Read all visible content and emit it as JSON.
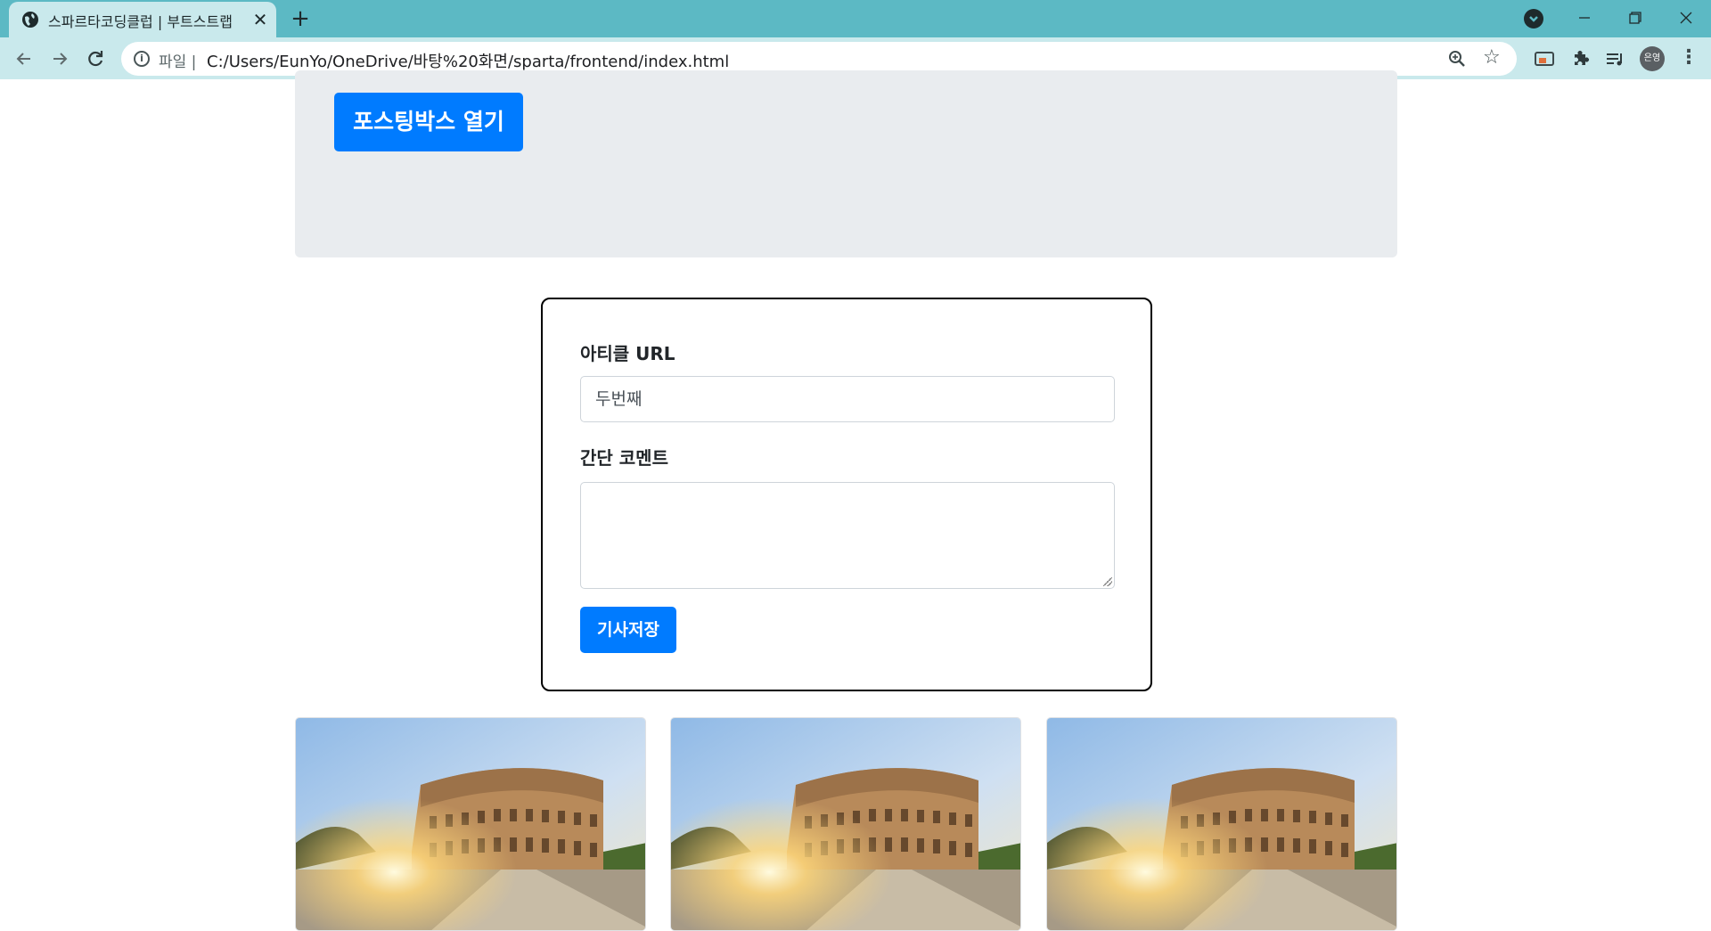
{
  "browser": {
    "tab_title": "스파르타코딩클럽 | 부트스트랩",
    "tab_close_glyph": "✕",
    "new_tab_glyph": "+",
    "address_chip": "파일 |",
    "url": "C:/Users/EunYo/OneDrive/바탕%20화면/sparta/frontend/index.html",
    "avatar_label": "은영",
    "icons": {
      "back": "arrow-left-icon",
      "forward": "arrow-right-icon",
      "reload": "reload-icon",
      "info": "info-icon",
      "zoom": "zoom-icon",
      "bookmark": "star-icon",
      "extensions": "puzzle-icon",
      "media": "media-queue-icon",
      "menu": "three-dots-icon"
    },
    "colors": {
      "frame": "#5cb9c4",
      "toolbar": "#c9e9ec"
    }
  },
  "page": {
    "open_button_label": "포스팅박스 열기",
    "form": {
      "url_label": "아티클 URL",
      "url_value": "두번째",
      "comment_label": "간단 코멘트",
      "comment_value": "",
      "save_button_label": "기사저장"
    },
    "cards": [
      {
        "image": "colosseum-image"
      },
      {
        "image": "colosseum-image"
      },
      {
        "image": "colosseum-image"
      }
    ],
    "colors": {
      "primary": "#007bff",
      "jumbotron": "#e9ecef"
    }
  }
}
